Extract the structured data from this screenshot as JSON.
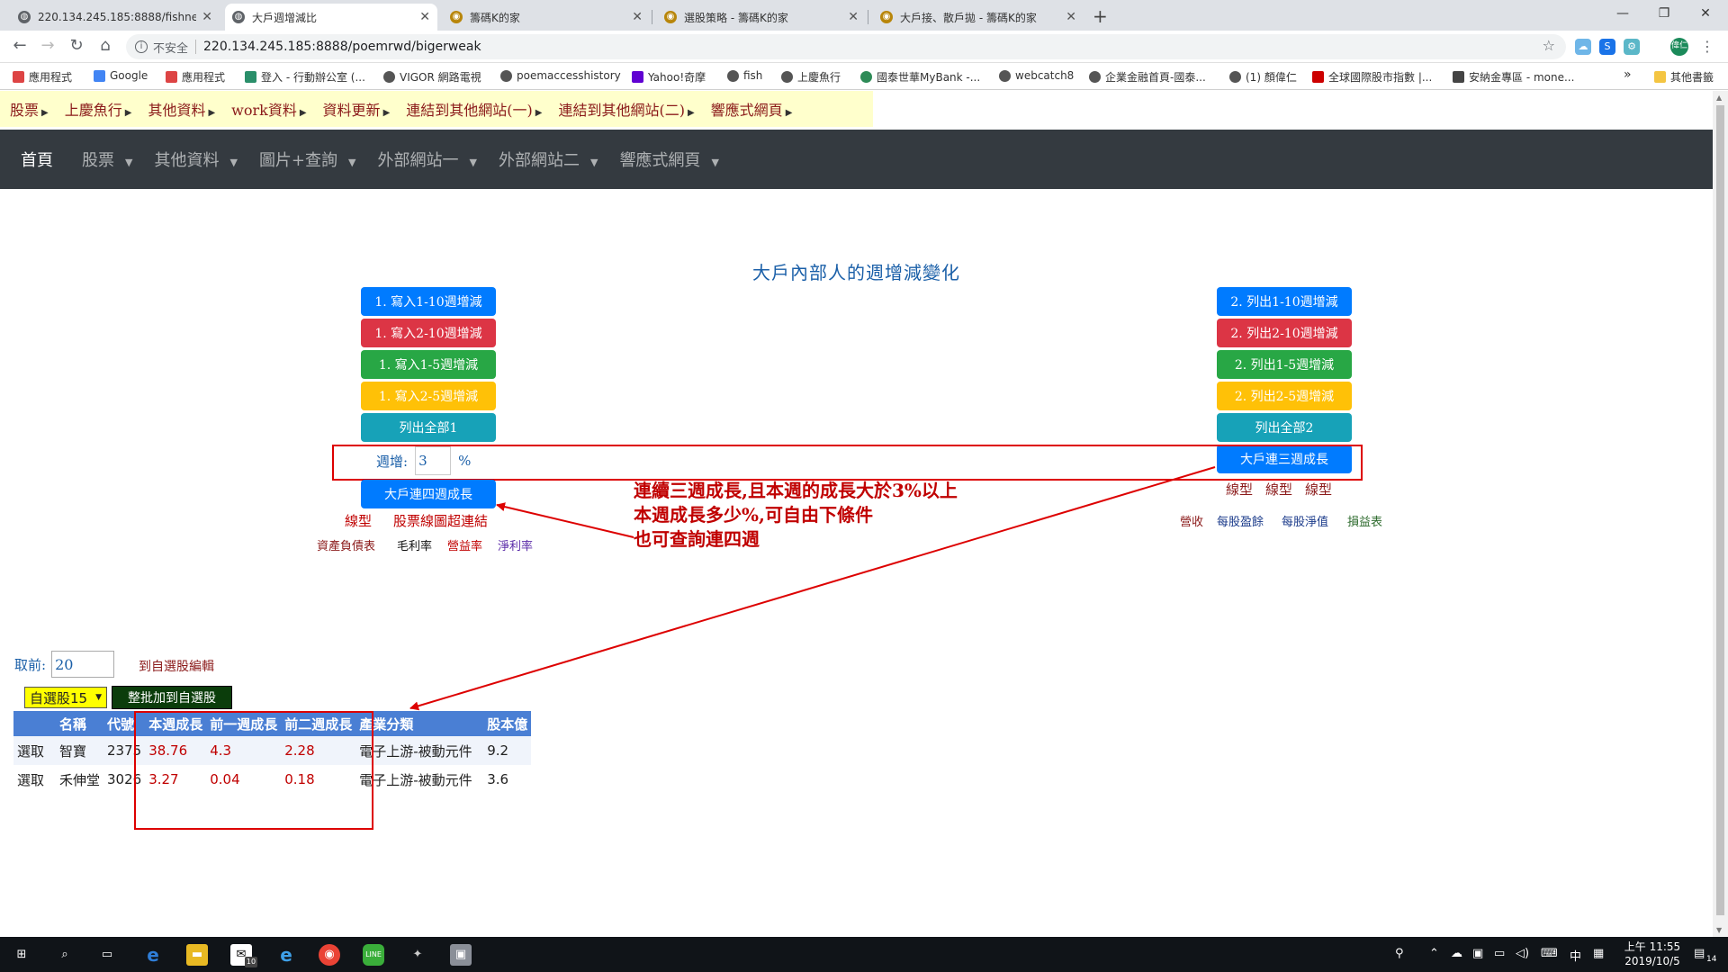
{
  "browser": {
    "tabs": [
      {
        "title": "220.134.245.185:8888/fishnew/",
        "active": false
      },
      {
        "title": "大戶週增減比",
        "active": true
      },
      {
        "title": "籌碼K的家",
        "active": false
      },
      {
        "title": "選股策略 - 籌碼K的家",
        "active": false
      },
      {
        "title": "大戶接、散戶拋 - 籌碼K的家",
        "active": false
      }
    ],
    "new_tab": "+",
    "window_controls": {
      "minimize": "—",
      "restore": "❐",
      "close": "✕"
    },
    "security_label": "不安全",
    "url": "220.134.245.185:8888/poemrwd/bigerweak",
    "profile": "偉仁",
    "bookmarks": [
      "應用程式",
      "Google",
      "應用程式",
      "登入 - 行動辦公室 (...",
      "VIGOR 網路電視",
      "poemaccesshistory",
      "Yahoo!奇摩",
      "fish",
      "上慶魚行",
      "國泰世華MyBank -...",
      "webcatch8",
      "企業金融首頁-國泰...",
      "(1) 顏偉仁",
      "全球國際股市指數 |...",
      "安納金專區 - mone..."
    ],
    "bookmarks_more": "»",
    "bookmarks_other": "其他書籤"
  },
  "old_menu": [
    "股票",
    "上慶魚行",
    "其他資料",
    "work資料",
    "資料更新",
    "連結到其他網站(一)",
    "連結到其他網站(二)",
    "響應式網頁"
  ],
  "navbar": {
    "home": "首頁",
    "items": [
      "股票",
      "其他資料",
      "圖片+查詢",
      "外部網站一",
      "外部網站二",
      "響應式網頁"
    ]
  },
  "heading": "大戶內部人的週增減變化",
  "left_buttons": [
    "1. 寫入1-10週增減",
    "1. 寫入2-10週增減",
    "1. 寫入1-5週增減",
    "1. 寫入2-5週增減",
    "列出全部1"
  ],
  "right_buttons": [
    "2. 列出1-10週增減",
    "2. 列出2-10週增減",
    "2. 列出1-5週增減",
    "2. 列出2-5週增減",
    "列出全部2"
  ],
  "week_filter": {
    "label": "週增:",
    "value": "3",
    "unit": "%"
  },
  "four_week_button": "大戶連四週成長",
  "three_week_button": "大戶連三週成長",
  "left_links_row1": [
    "線型",
    "股票線圖超連結"
  ],
  "left_links_row2": [
    "資產負債表",
    "毛利率",
    "營益率",
    "淨利率"
  ],
  "right_links_row1": [
    "線型",
    "線型",
    "線型"
  ],
  "right_links_row2": [
    "營收",
    "每股盈餘",
    "每股淨值",
    "損益表"
  ],
  "annotation": [
    "連續三週成長,且本週的成長大於3%以上",
    "本週成長多少%,可自由下條件",
    "也可查詢連四週"
  ],
  "take_top": {
    "label": "取前:",
    "value": "20"
  },
  "to_edit_link": "到自選股編輯",
  "watchlist_select": "自選股15",
  "batch_add_button": "整批加到自選股",
  "table": {
    "headers": [
      "",
      "名稱",
      "代號",
      "本週成長",
      "前一週成長",
      "前二週成長",
      "產業分類",
      "股本億"
    ],
    "rows": [
      {
        "action": "選取",
        "name": "智寶",
        "code": "2375",
        "w0": "38.76",
        "w1": "4.3",
        "w2": "2.28",
        "industry": "電子上游-被動元件",
        "capital": "9.2"
      },
      {
        "action": "選取",
        "name": "禾伸堂",
        "code": "3026",
        "w0": "3.27",
        "w1": "0.04",
        "w2": "0.18",
        "industry": "電子上游-被動元件",
        "capital": "3.6"
      }
    ]
  },
  "taskbar": {
    "time": "上午 11:55",
    "date": "2019/10/5",
    "ime": "中",
    "mail_badge": "10",
    "notifications": "14"
  }
}
